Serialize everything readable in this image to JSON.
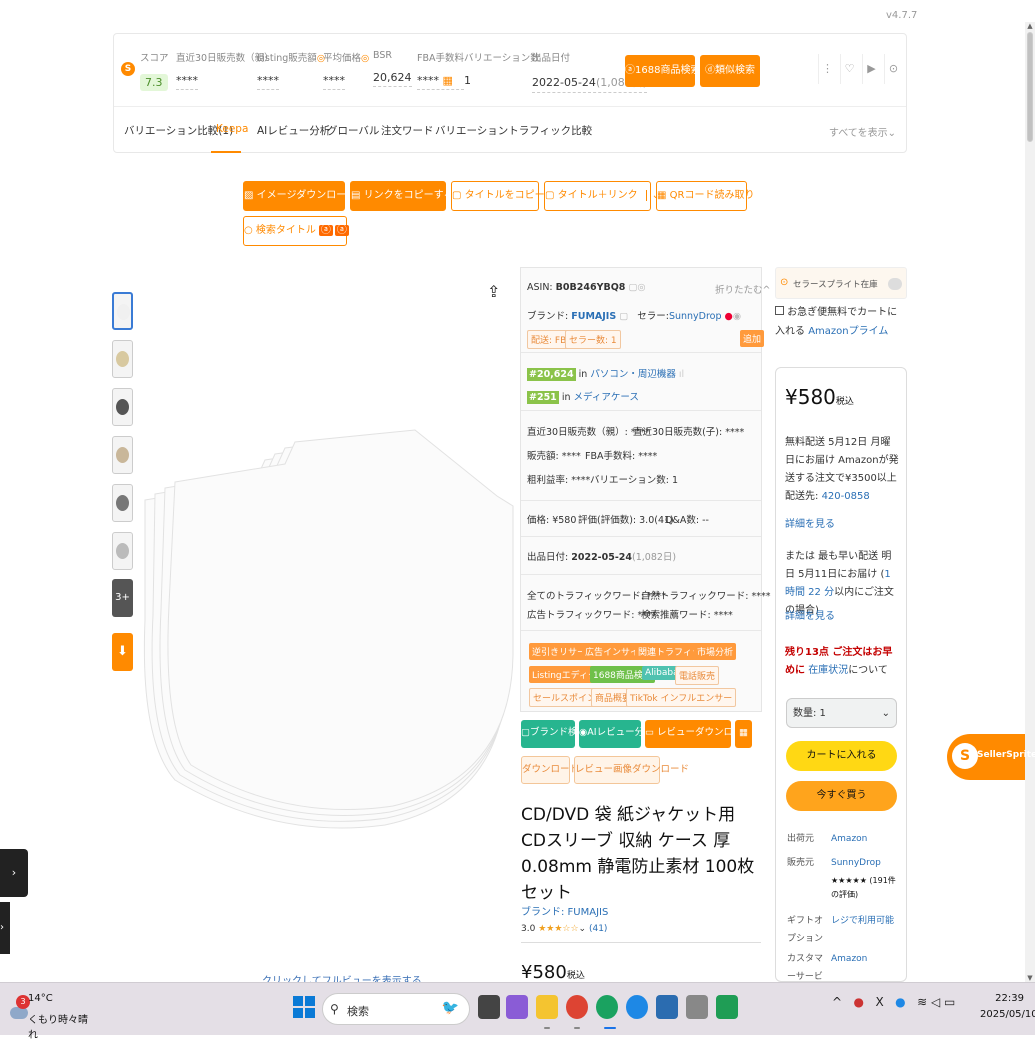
{
  "version": "v4.7.7",
  "stats": {
    "score_label": "スコア",
    "score_value": "7.3",
    "items": [
      {
        "label": "直近30日販売数（親）",
        "value": "****"
      },
      {
        "label": "Listing販売額",
        "value": "****"
      },
      {
        "label": "平均価格",
        "value": "****"
      },
      {
        "label": "BSR",
        "value": "20,624"
      },
      {
        "label": "FBA手数料",
        "value": "****"
      },
      {
        "label": "バリエーション数",
        "value": "1"
      },
      {
        "label": "出品日付",
        "value": "2022-05-24",
        "extra": "(1,082日)"
      }
    ],
    "btn_1688": "1688商品検索",
    "btn_similar": "類似検索"
  },
  "tabs": {
    "items": [
      "バリエーション比較(1)",
      "Keepa",
      "AIレビュー分析",
      "グローバル",
      "注文ワード",
      "バリエーショントラフィック比較"
    ],
    "active": "Keepa",
    "show_all": "すべてを表示"
  },
  "toolbar": {
    "image_download": "イメージダウンロード",
    "copy_link": "リンクをコピーする",
    "copy_title": "タイトルをコピー",
    "title_link": "タイトル＋リンク",
    "qr_read": "QRコード読み取り",
    "search_title": "検索タイトル"
  },
  "thumbs": {
    "more": "3+"
  },
  "info": {
    "asin_label": "ASIN:",
    "asin": "B0B246YBQ8",
    "collapse": "折りたたむ",
    "brand_label": "ブランド:",
    "brand": "FUMAJIS",
    "seller_label": "セラー:",
    "seller": "SunnyDrop",
    "fba_tag": "配送: FBA",
    "seller_count_tag": "セラー数: 1",
    "add_btn": "追加",
    "rank1": "#20,624",
    "rank1_in": "in",
    "rank1_cat": "パソコン・周辺機器",
    "rank2": "#251",
    "rank2_in": "in",
    "rank2_cat": "メディアケース",
    "sales_parent": "直近30日販売数（親）: ****",
    "sales_child": "直近30日販売数(子): ****",
    "sales_amount": "販売額: ****",
    "fba_fee": "FBA手数料: ****",
    "gross_margin": "粗利益率: ****",
    "variations": "バリエーション数: 1",
    "price_line": "価格: ¥580",
    "rating_line": "評価(評価数): 3.0(41)",
    "qa_line": "Q&A数: --",
    "listing_date_label": "出品日付:",
    "listing_date": "2022-05-24",
    "listing_days": "(1,082日)",
    "traffic_all": "全てのトラフィックワード: ****",
    "traffic_natural": "自然トラフィックワード: ****",
    "traffic_ad": "広告トラフィックワード: ****",
    "traffic_recommend": "検索推薦ワード: ****",
    "tags_row1": [
      "逆引きリサーチ",
      "広告インサイト",
      "関連トラフィック",
      "市場分析"
    ],
    "tags_row2": [
      "Listingエディター",
      "1688商品検索",
      "Alibaba",
      "電話販売"
    ],
    "tags_row3": [
      "セールスポイント",
      "商品概要",
      "TikTok インフルエンサー"
    ]
  },
  "actions": {
    "brand_detect": "ブランド検出",
    "ai_review": "AIレビュー分析",
    "review_download": "レビューダウンロード",
    "download": "ダウンロード",
    "review_image_download": "レビュー画像ダウンロード"
  },
  "product": {
    "title": "CD/DVD 袋 紙ジャケット用 CDスリーブ 収納 ケース 厚0.08mm 静電防止素材 100枚セット",
    "brand_link": "ブランド: FUMAJIS",
    "rating_value": "3.0",
    "rating_stars": "★★★☆☆",
    "rating_count": "(41)",
    "price": "¥580",
    "price_suffix": "税込",
    "click_enlarge": "クリックしてフルビューを表示する"
  },
  "buybox": {
    "sp_label": "セラースプライト在庫",
    "prime_text": "お急ぎ便無料でカートに入れる",
    "prime_link": "Amazonプライム",
    "price": "¥580",
    "price_suffix": "税込",
    "delivery1": "無料配送  5月12日 月曜日にお届け  Amazonが発送する注文で¥3500以上  配送先:",
    "delivery1_link": "420-0858",
    "details1": "詳細を見る",
    "delivery2": "または 最も早い配送  明日 5月11日にお届け (",
    "delivery2_link": "1 時間 22 分",
    "delivery2_tail": "以内にご注文の場合)",
    "details2": "詳細を見る",
    "stock_red": "残り13点 ご注文はお早めに",
    "stock_link": "在庫状況",
    "stock_tail": "について",
    "qty_label": "数量: 1",
    "add_to_cart": "カートに入れる",
    "buy_now": "今すぐ買う",
    "shipper_k": "出荷元",
    "shipper_v": "Amazon",
    "seller_k": "販売元",
    "seller_v": "SunnyDrop",
    "seller_rating": "★★★★★ (191件の評価)",
    "gift_k": "ギフトオプション",
    "gift_v": "レジで利用可能",
    "cs_k": "カスタマーサービス",
    "cs_v": "Amazon"
  },
  "seller_float": "SellerSprite",
  "taskbar": {
    "weather_badge": "3",
    "temp": "14°C",
    "weather_desc": "くもり時々晴れ",
    "search_placeholder": "検索",
    "time": "22:39",
    "date": "2025/05/10"
  }
}
